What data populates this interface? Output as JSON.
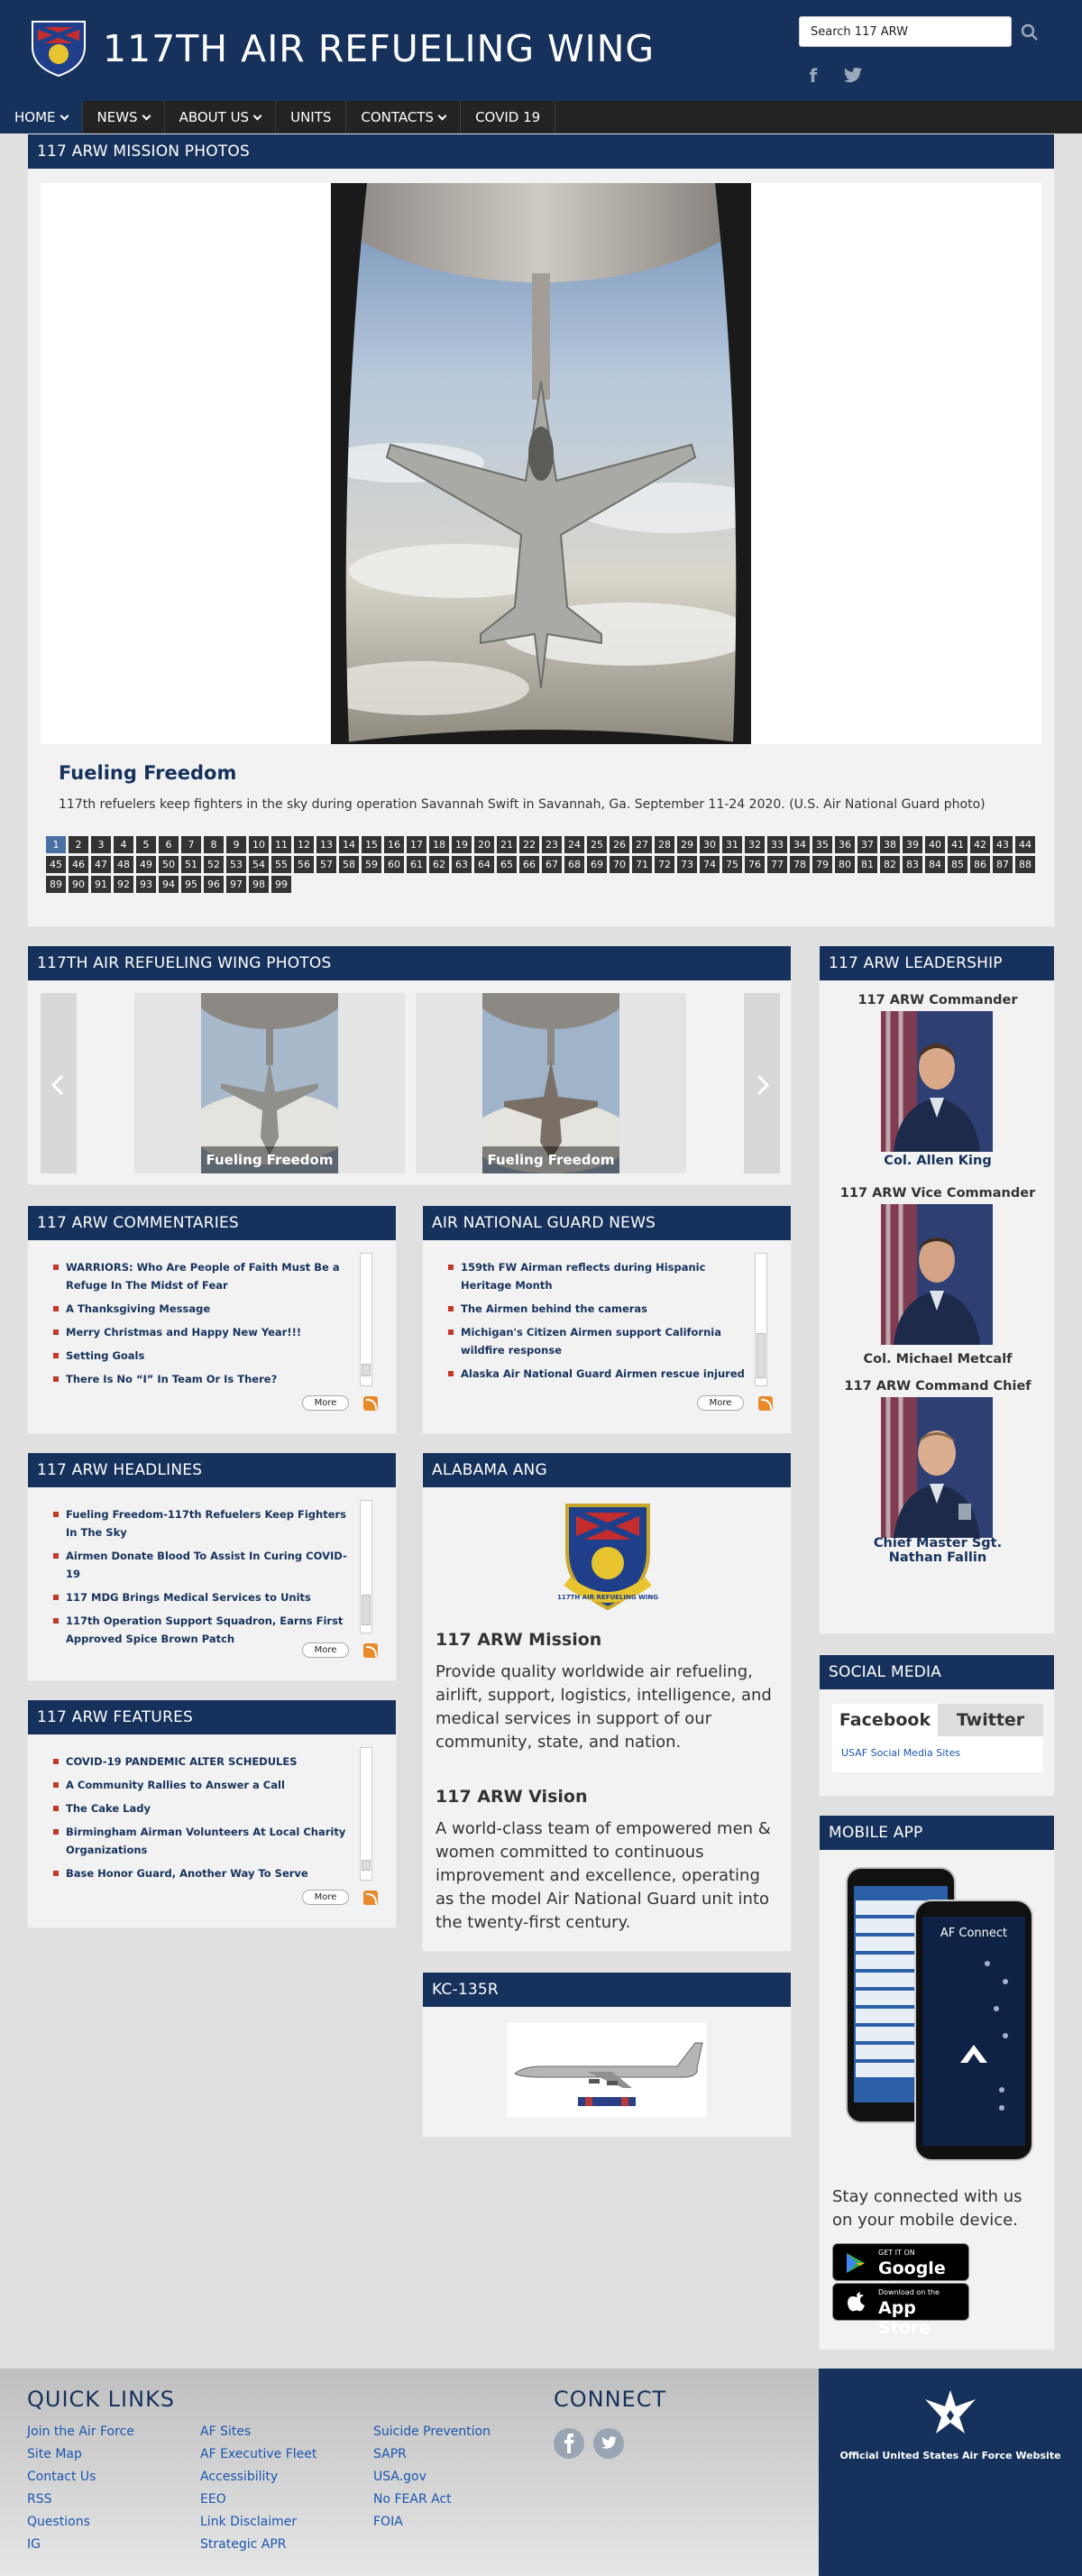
{
  "header": {
    "title": "117TH AIR REFUELING WING",
    "search_placeholder": "Search 117 ARW"
  },
  "nav": [
    "HOME",
    "NEWS",
    "ABOUT US",
    "UNITS",
    "CONTACTS",
    "COVID 19"
  ],
  "mission_photos": {
    "heading": "117 ARW MISSION PHOTOS",
    "photo_title": "Fueling Freedom",
    "caption": "117th refuelers keep fighters in the sky during operation Savannah Swift in Savannah, Ga. September 11-24 2020. (U.S. Air National Guard photo)",
    "pages": [
      "1",
      "2",
      "3",
      "4",
      "5",
      "6",
      "7",
      "8",
      "9",
      "10",
      "11",
      "12",
      "13",
      "14",
      "15",
      "16",
      "17",
      "18",
      "19",
      "20",
      "21",
      "22",
      "23",
      "24",
      "25",
      "26",
      "27",
      "28",
      "29",
      "30",
      "31",
      "32",
      "33",
      "34",
      "35",
      "36",
      "37",
      "38",
      "39",
      "40",
      "41",
      "42",
      "43",
      "44",
      "45",
      "46",
      "47",
      "48",
      "49",
      "50",
      "51",
      "52",
      "53",
      "54",
      "55",
      "56",
      "57",
      "58",
      "59",
      "60",
      "61",
      "62",
      "63",
      "64",
      "65",
      "66",
      "67",
      "68",
      "69",
      "70",
      "71",
      "72",
      "73",
      "74",
      "75",
      "76",
      "77",
      "78",
      "79",
      "80",
      "81",
      "82",
      "83",
      "84",
      "85",
      "86",
      "87",
      "88",
      "89",
      "90",
      "91",
      "92",
      "93",
      "94",
      "95",
      "96",
      "97",
      "98",
      "99"
    ]
  },
  "wing_photos": {
    "heading": "117TH AIR REFUELING WING PHOTOS",
    "items": [
      {
        "caption": "Fueling Freedom"
      },
      {
        "caption": "Fueling Freedom"
      }
    ]
  },
  "commentaries": {
    "heading": "117 ARW COMMENTARIES",
    "items": [
      "WARRIORS: Who Are People of Faith Must Be a Refuge In The Midst of Fear",
      "A Thanksgiving Message",
      "Merry Christmas and Happy New Year!!!",
      "Setting Goals",
      "There Is No “I” In Team Or Is There?"
    ],
    "more": "More"
  },
  "ang_news": {
    "heading": "AIR NATIONAL GUARD NEWS",
    "items": [
      "159th FW Airman reflects during Hispanic Heritage Month",
      "The Airmen behind the cameras",
      "Michigan's Citizen Airmen support California wildfire response",
      "Alaska Air National Guard Airmen rescue injured"
    ],
    "more": "More"
  },
  "headlines": {
    "heading": "117 ARW HEADLINES",
    "items": [
      "Fueling Freedom-117th Refuelers Keep Fighters In The Sky",
      "Airmen Donate Blood To Assist In Curing COVID-19",
      "117 MDG Brings Medical Services to Units",
      "117th Operation Support Squadron, Earns First Approved Spice Brown Patch"
    ],
    "more": "More"
  },
  "features": {
    "heading": "117 ARW FEATURES",
    "items": [
      "COVID-19 PANDEMIC ALTER SCHEDULES",
      "A Community Rallies to Answer a Call",
      "The Cake Lady",
      "Birmingham Airman Volunteers At Local Charity Organizations",
      "Base Honor Guard, Another Way To Serve"
    ],
    "more": "More"
  },
  "leadership": {
    "heading": "117 ARW LEADERSHIP",
    "leaders": [
      {
        "role": "117 ARW Commander",
        "name": "Col. Allen King"
      },
      {
        "role": "117 ARW Vice Commander",
        "name": "Col. Michael Metcalf"
      },
      {
        "role": "117 ARW Command Chief",
        "name": "Chief Master Sgt. Nathan Fallin"
      }
    ]
  },
  "alabama": {
    "heading": "ALABAMA ANG",
    "emblem_text": "117TH AIR REFUELING WING",
    "mission_title": "117 ARW Mission",
    "mission_text": "Provide quality worldwide air refueling, airlift, support, logistics, intelligence, and medical services in support of our community, state, and nation.",
    "vision_title": "117 ARW Vision",
    "vision_text": "A world-class team of empowered men & women committed to continuous improvement and excellence, operating as the model Air National Guard unit into the twenty-first century."
  },
  "social": {
    "heading": "SOCIAL MEDIA",
    "tabs": [
      "Facebook",
      "Twitter"
    ],
    "link": "USAF Social Media Sites"
  },
  "mobile": {
    "heading": "MOBILE APP",
    "app_name": "AF Connect",
    "text": "Stay connected with us on your mobile device.",
    "google_small": "GET IT ON",
    "google_big": "Google Play",
    "apple_small": "Download on the",
    "apple_big": "App Store"
  },
  "kc135": {
    "heading": "KC-135R"
  },
  "footer": {
    "quick_links_title": "QUICK LINKS",
    "col1": [
      "Join the Air Force",
      "Site Map",
      "Contact Us",
      "RSS",
      "Questions",
      "IG"
    ],
    "col2": [
      "AF Sites",
      "AF Executive Fleet",
      "Accessibility",
      "EEO",
      "Link Disclaimer",
      "Strategic APR"
    ],
    "col3": [
      "Suicide Prevention",
      "SAPR",
      "USA.gov",
      "No FEAR Act",
      "FOIA"
    ],
    "connect_title": "CONNECT",
    "af_link": "Official United States Air Force Website"
  },
  "colors": {
    "brand_navy": "#16325c",
    "nav_dark": "#232323",
    "bullet_red": "#c0392b",
    "rss_orange": "#e8892b"
  }
}
